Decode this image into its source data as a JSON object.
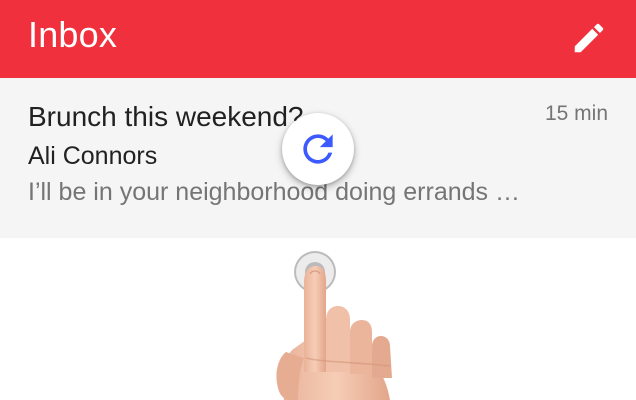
{
  "app_bar": {
    "title": "Inbox",
    "color": "#f0303c",
    "action_icon": "pencil-icon"
  },
  "email": {
    "subject": "Brunch this weekend?",
    "time": "15 min",
    "sender": "Ali Connors",
    "snippet": "I’ll be in your neighborhood doing errands …"
  },
  "refresh": {
    "icon": "refresh-icon",
    "color": "#3d5afe"
  }
}
